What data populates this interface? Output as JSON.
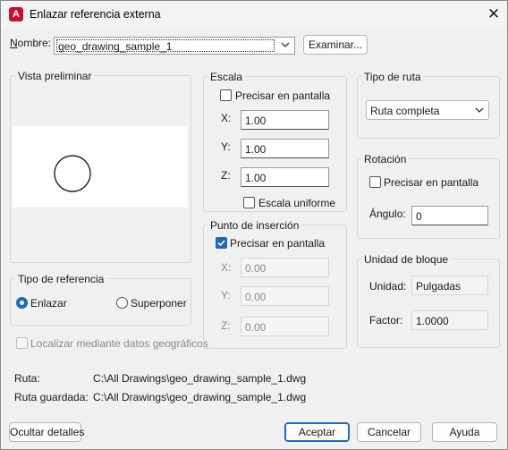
{
  "window": {
    "title": "Enlazar referencia externa",
    "app_icon_letter": "A",
    "close_glyph": "✕"
  },
  "name_row": {
    "label": "Nombre:",
    "value": "geo_drawing_sample_1",
    "browse_label": "Examinar..."
  },
  "preview": {
    "title": "Vista preliminar"
  },
  "ref_type": {
    "title": "Tipo de referencia",
    "options": [
      {
        "label": "Enlazar",
        "selected": true
      },
      {
        "label": "Superponer",
        "selected": false
      }
    ]
  },
  "geo": {
    "label": "Localizar mediante datos geográficos",
    "checked": false,
    "enabled": false
  },
  "scale": {
    "title": "Escala",
    "specify_label": "Precisar en pantalla",
    "specify_checked": false,
    "x_label": "X:",
    "x_value": "1.00",
    "y_label": "Y:",
    "y_value": "1.00",
    "z_label": "Z:",
    "z_value": "1.00",
    "uniform_label": "Escala uniforme",
    "uniform_checked": false
  },
  "insertion": {
    "title": "Punto de inserción",
    "specify_label": "Precisar en pantalla",
    "specify_checked": true,
    "x_label": "X:",
    "x_value": "0.00",
    "y_label": "Y:",
    "y_value": "0.00",
    "z_label": "Z:",
    "z_value": "0.00"
  },
  "path_type": {
    "title": "Tipo de ruta",
    "selected": "Ruta completa"
  },
  "rotation": {
    "title": "Rotación",
    "specify_label": "Precisar en pantalla",
    "specify_checked": false,
    "angle_label": "Ángulo:",
    "angle_value": "0"
  },
  "block_unit": {
    "title": "Unidad de bloque",
    "unit_label": "Unidad:",
    "unit_value": "Pulgadas",
    "factor_label": "Factor:",
    "factor_value": "1.0000"
  },
  "paths": {
    "path_label": "Ruta:",
    "path_value": "C:\\All Drawings\\geo_drawing_sample_1.dwg",
    "saved_label": "Ruta guardada:",
    "saved_value": "C:\\All Drawings\\geo_drawing_sample_1.dwg"
  },
  "footer": {
    "hide_details_label": "Ocultar detalles",
    "accept_label": "Aceptar",
    "cancel_label": "Cancelar",
    "help_label": "Ayuda"
  },
  "colors": {
    "accent": "#1e6ab8",
    "app_icon": "#c8102e"
  }
}
